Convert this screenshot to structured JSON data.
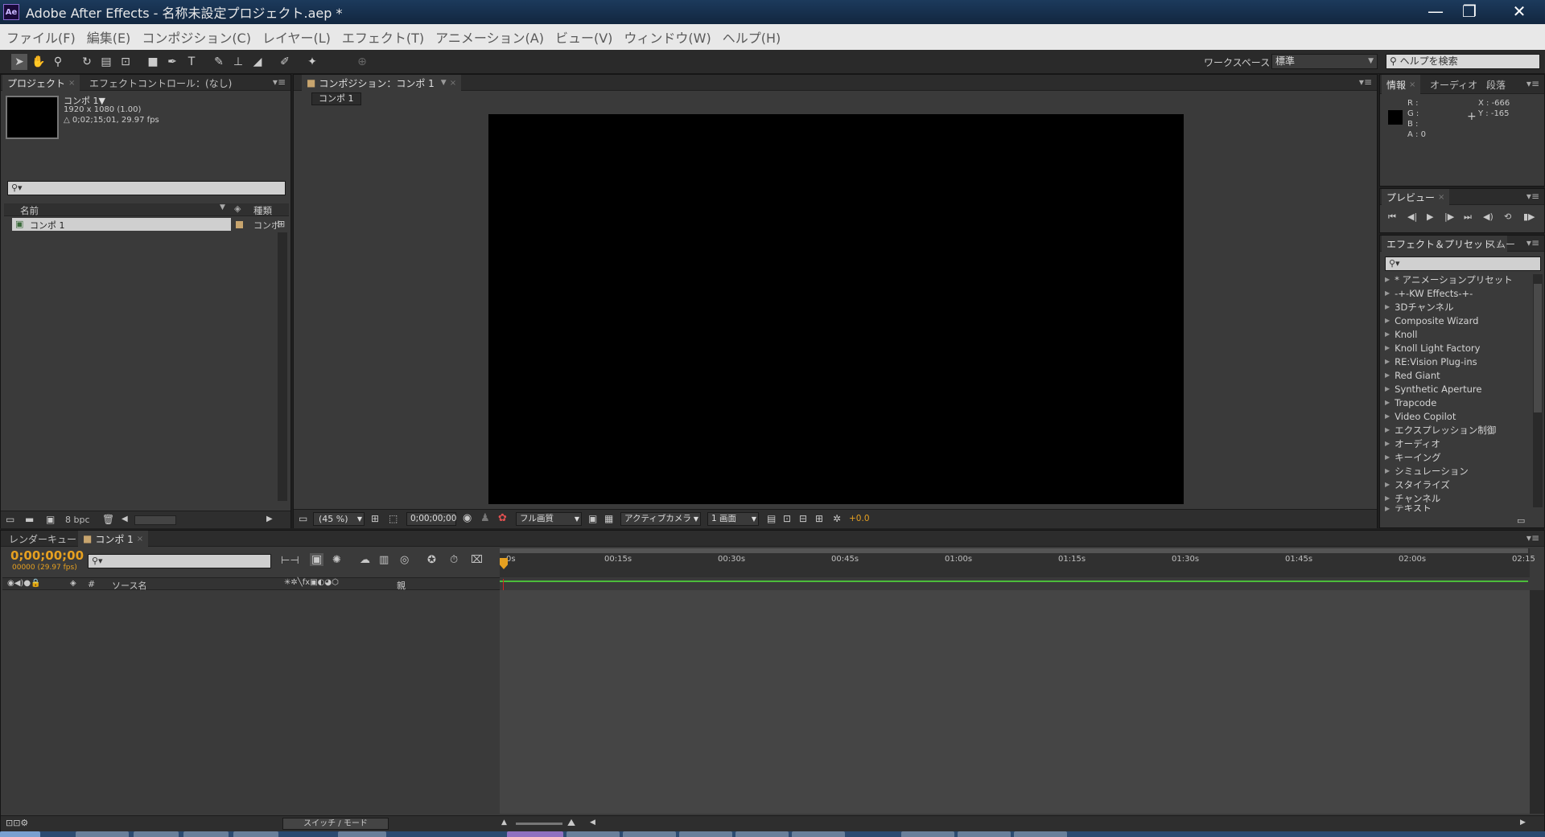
{
  "window": {
    "title": "Adobe After Effects - 名称未設定プロジェクト.aep *",
    "logo": "Ae"
  },
  "menu": [
    "ファイル(F)",
    "編集(E)",
    "コンポジション(C)",
    "レイヤー(L)",
    "エフェクト(T)",
    "アニメーション(A)",
    "ビュー(V)",
    "ウィンドウ(W)",
    "ヘルプ(H)"
  ],
  "toolbar": {
    "workspace_label": "ワークスペース：",
    "workspace_value": "標準",
    "help_search_placeholder": "ヘルプを検索"
  },
  "project_panel": {
    "tabs": [
      "プロジェクト",
      "エフェクトコントロール：(なし)"
    ],
    "comp_name": "コンポ 1▼",
    "comp_size": "1920 x 1080 (1.00)",
    "comp_duration": "△ 0;02;15;01, 29.97 fps",
    "col_name": "名前",
    "col_type": "種類",
    "items": [
      {
        "name": "コンポ 1",
        "type": "コンポ"
      }
    ],
    "bpc": "8 bpc"
  },
  "comp_panel": {
    "tab": "コンポジション：コンポ 1",
    "subtab": "コンポ 1",
    "zoom": "(45 %)",
    "timecode": "0;00;00;00",
    "resolution": "フル画質",
    "camera": "アクティブカメラ",
    "views": "1 画面",
    "exposure": "+0.0"
  },
  "info_panel": {
    "tabs": [
      "情報",
      "オーディオ",
      "段落"
    ],
    "r": "R :",
    "g": "G :",
    "b": "B :",
    "a": "A : 0",
    "x": "X : -666",
    "y": "Y : -165"
  },
  "preview_panel": {
    "tab": "プレビュー"
  },
  "effects_panel": {
    "tabs": [
      "エフェクト＆プリセット",
      "スムー"
    ],
    "items": [
      "* アニメーションプリセット",
      "-+-KW Effects-+-",
      "3Dチャンネル",
      "Composite Wizard",
      "Knoll",
      "Knoll Light Factory",
      "RE:Vision Plug-ins",
      "Red Giant",
      "Synthetic Aperture",
      "Trapcode",
      "Video Copilot",
      "エクスプレッション制御",
      "オーディオ",
      "キーイング",
      "シミュレーション",
      "スタイライズ",
      "チャンネル",
      "テキスト"
    ]
  },
  "timeline": {
    "tabs": [
      "レンダーキュー",
      "コンポ 1"
    ],
    "timecode": "0;00;00;00",
    "frames": "00000 (29.97 fps)",
    "col_source": "ソース名",
    "col_parent": "親",
    "col_num": "#",
    "switch_mode": "スイッチ / モード",
    "ticks": [
      "0s",
      "00:15s",
      "00:30s",
      "00:45s",
      "01:00s",
      "01:15s",
      "01:30s",
      "01:45s",
      "02:00s",
      "02:15"
    ]
  },
  "colors": {
    "accent_orange": "#e6a020",
    "work_area_green": "#4bbd3a",
    "playhead_red": "#d02020"
  }
}
